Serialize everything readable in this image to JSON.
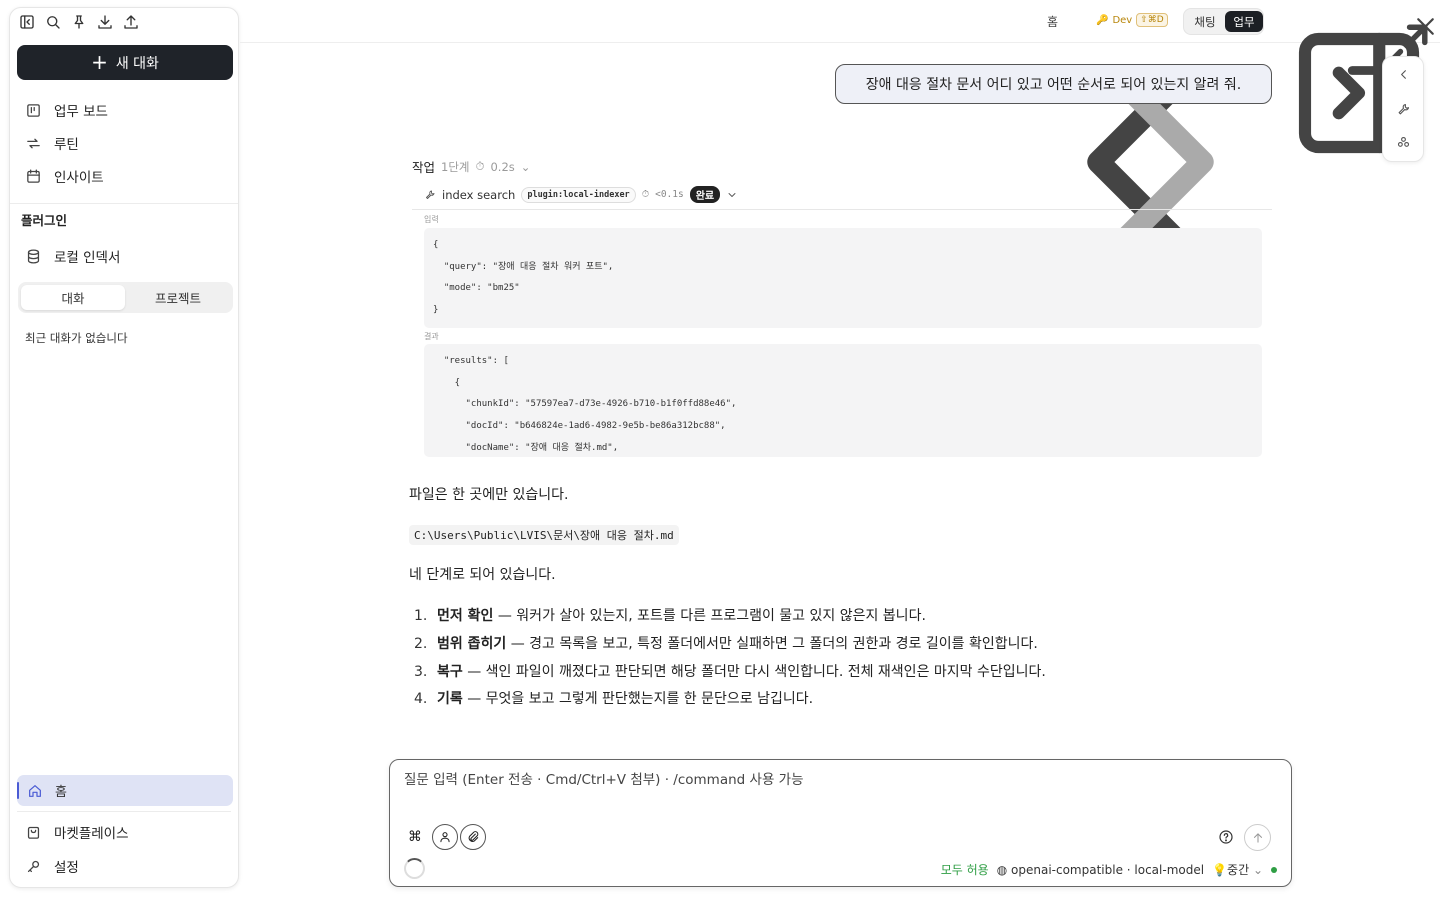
{
  "sidebar": {
    "new_chat_label": "새 대화",
    "nav": [
      {
        "label": "업무 보드",
        "icon": "kanban-icon"
      },
      {
        "label": "루틴",
        "icon": "repeat-icon"
      },
      {
        "label": "인사이트",
        "icon": "calendar-icon"
      }
    ],
    "plugins_heading": "플러그인",
    "plugin_item": "로컬 인덱서",
    "tabs": [
      "대화",
      "프로젝트"
    ],
    "empty_text": "최근 대화가 없습니다",
    "home_label": "홈",
    "marketplace_label": "마켓플레이스",
    "settings_label": "설정"
  },
  "topbar": {
    "home_label": "홈",
    "dev_label": "Dev",
    "dev_shortcut": "⇧⌘D",
    "mode_tabs": [
      "채팅",
      "업무"
    ],
    "active_mode": "업무"
  },
  "chat": {
    "user_message": "장애 대응 절차 문서 어디 있고 어떤 순서로 되어 있는지 알려 줘.",
    "task": {
      "label": "작업",
      "steps": "1단계",
      "duration": "0.2s",
      "tool_name": "index search",
      "plugin_tag": "plugin:local-indexer",
      "tool_time": "<0.1s",
      "status": "완료",
      "input_label": "입력",
      "input_code": "{\n  \"query\": \"장애 대응 절차 워커 포트\",\n  \"mode\": \"bm25\"\n}",
      "result_label": "결과",
      "result_code": "  \"results\": [\n    {\n      \"chunkId\": \"57597ea7-d73e-4926-b710-b1f0ffd88e46\",\n      \"docId\": \"b646824e-1ad6-4982-9e5b-be86a312bc88\",\n      \"docName\": \"장애 대응 절차.md\","
    },
    "answer": {
      "p1": "파일은 한 곳에만 있습니다.",
      "path": "C:\\Users\\Public\\LVIS\\문서\\장애 대응 절차.md",
      "p2": "네 단계로 되어 있습니다.",
      "steps": [
        {
          "n": "1.",
          "title": "먼저 확인",
          "text": " — 워커가 살아 있는지, 포트를 다른 프로그램이 물고 있지 않은지 봅니다."
        },
        {
          "n": "2.",
          "title": "범위 좁히기",
          "text": " — 경고 목록을 보고, 특정 폴더에서만 실패하면 그 폴더의 권한과 경로 길이를 확인합니다."
        },
        {
          "n": "3.",
          "title": "복구",
          "text": " — 색인 파일이 깨졌다고 판단되면 해당 폴더만 다시 색인합니다. 전체 재색인은 마지막 수단입니다."
        },
        {
          "n": "4.",
          "title": "기록",
          "text": " — 무엇을 보고 그렇게 판단했는지를 한 문단으로 남깁니다."
        }
      ]
    }
  },
  "composer": {
    "placeholder": "질문 입력 (Enter 전송 · Cmd/Ctrl+V 첨부) · /command 사용 가능",
    "permission": "모두 허용",
    "model": "openai-compatible · local-model",
    "effort": "중간",
    "colors": {
      "accent": "#4a5bd4",
      "status_green": "#2f9e44"
    }
  }
}
